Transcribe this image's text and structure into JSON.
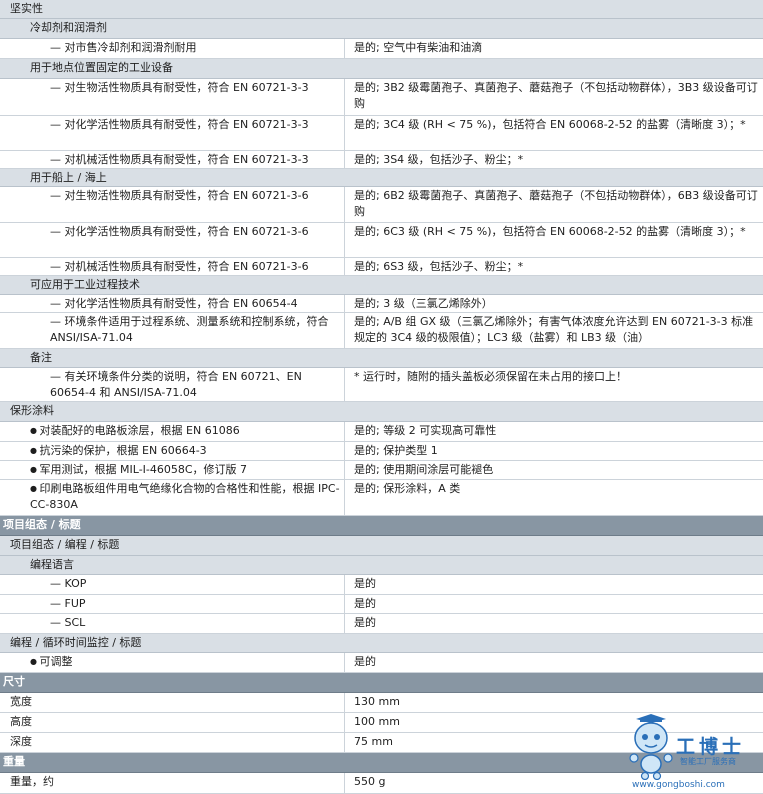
{
  "rows": {
    "r0": {
      "label": "坚实性"
    },
    "r1": {
      "label": "冷却剂和润滑剂"
    },
    "r2": {
      "label": "对市售冷却剂和润滑剂耐用",
      "value": "是的; 空气中有柴油和油滴"
    },
    "r3": {
      "label": "用于地点位置固定的工业设备"
    },
    "r4": {
      "label": "对生物活性物质具有耐受性，符合 EN 60721-3-3",
      "value": "是的; 3B2 级霉菌孢子、真菌孢子、蘑菇孢子（不包括动物群体），3B3 级设备可订购"
    },
    "r5": {
      "label": "对化学活性物质具有耐受性，符合 EN 60721-3-3",
      "value": "是的; 3C4 级 (RH < 75 %)，包括符合 EN 60068-2-52 的盐雾（清晰度 3）；*"
    },
    "r6": {
      "label": "对机械活性物质具有耐受性，符合 EN 60721-3-3",
      "value": "是的; 3S4 级，包括沙子、粉尘；*"
    },
    "r7": {
      "label": "用于船上 / 海上"
    },
    "r8": {
      "label": "对生物活性物质具有耐受性，符合 EN 60721-3-6",
      "value": "是的; 6B2 级霉菌孢子、真菌孢子、蘑菇孢子（不包括动物群体），6B3 级设备可订购"
    },
    "r9": {
      "label": "对化学活性物质具有耐受性，符合 EN 60721-3-6",
      "value": "是的; 6C3 级 (RH < 75 %)，包括符合 EN 60068-2-52 的盐雾（清晰度 3）；*"
    },
    "r10": {
      "label": "对机械活性物质具有耐受性，符合 EN 60721-3-6",
      "value": "是的; 6S3 级，包括沙子、粉尘；*"
    },
    "r11": {
      "label": "可应用于工业过程技术"
    },
    "r12": {
      "label": "对化学活性物质具有耐受性，符合 EN 60654-4",
      "value": "是的; 3 级（三氯乙烯除外）"
    },
    "r13": {
      "label": "环境条件适用于过程系统、测量系统和控制系统，符合 ANSI/ISA-71.04",
      "value": "是的; A/B 组 GX 级（三氯乙烯除外；有害气体浓度允许达到 EN 60721-3-3 标准规定的 3C4 级的极限值）；LC3 级（盐雾）和 LB3 级（油）"
    },
    "r14": {
      "label": "备注"
    },
    "r15": {
      "label": "有关环境条件分类的说明，符合 EN 60721、EN 60654-4 和 ANSI/ISA-71.04",
      "value": "* 运行时，随附的插头盖板必须保留在未占用的接口上！"
    },
    "r16": {
      "label": "保形涂料"
    },
    "r17": {
      "label": "对装配好的电路板涂层，根据 EN 61086",
      "value": "是的; 等级 2 可实现高可靠性"
    },
    "r18": {
      "label": "抗污染的保护，根据 EN 60664-3",
      "value": "是的; 保护类型 1"
    },
    "r19": {
      "label": "军用测试，根据 MIL-I-46058C，修订版 7",
      "value": "是的; 使用期间涂层可能褪色"
    },
    "r20": {
      "label": "印刷电路板组件用电气绝缘化合物的合格性和性能，根据 IPC-CC-830A",
      "value": "是的; 保形涂料，A 类"
    },
    "r21": {
      "label": "项目组态 / 标题"
    },
    "r22": {
      "label": "项目组态 / 编程 / 标题"
    },
    "r23": {
      "label": "编程语言"
    },
    "r24": {
      "label": "KOP",
      "value": "是的"
    },
    "r25": {
      "label": "FUP",
      "value": "是的"
    },
    "r26": {
      "label": "SCL",
      "value": "是的"
    },
    "r27": {
      "label": "编程 / 循环时间监控 / 标题"
    },
    "r28": {
      "label": "可调整",
      "value": "是的"
    },
    "r29": {
      "label": "尺寸"
    },
    "r30": {
      "label": "宽度",
      "value": "130 mm"
    },
    "r31": {
      "label": "高度",
      "value": "100 mm"
    },
    "r32": {
      "label": "深度",
      "value": "75 mm"
    },
    "r33": {
      "label": "重量"
    },
    "r34": {
      "label": "重量，约",
      "value": "550 g"
    }
  },
  "watermark": {
    "brand": "工博士",
    "tagline": "智能工厂服务商",
    "url": "www.gongboshi.com",
    "accent": "#2a6fb8",
    "icon": "robot-mascot-icon"
  }
}
